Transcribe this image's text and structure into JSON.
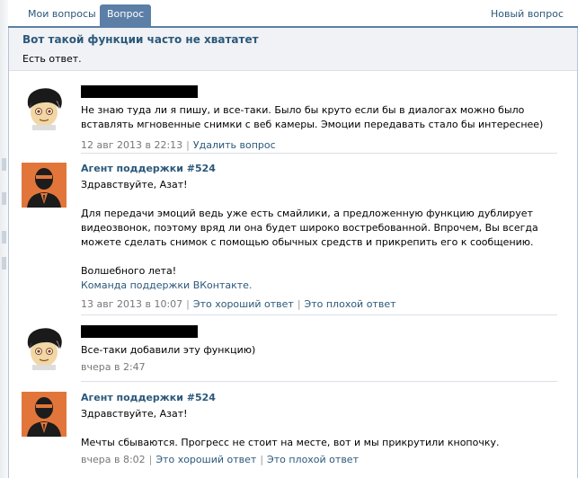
{
  "tabs": {
    "my_questions": "Мои вопросы",
    "question": "Вопрос",
    "new_question": "Новый вопрос"
  },
  "question": {
    "title": "Вот такой функции часто не хвататет",
    "status": "Есть ответ."
  },
  "messages": [
    {
      "author": "",
      "author_redacted": true,
      "avatar": "user-avatar-icon",
      "paragraphs": [
        "Не знаю туда ли я пишу, и все-таки. Было бы круто если бы в диалогах можно было вставлять мгновенные снимки с веб камеры. Эмоции передавать стало бы интереснее)"
      ],
      "date": "12 авг 2013 в 22:13",
      "actions": [
        "Удалить вопрос"
      ]
    },
    {
      "author": "Агент поддержки #524",
      "avatar": "support-agent-avatar-icon",
      "paragraphs": [
        "Здравствуйте, Азат!",
        "Для передачи эмоций ведь уже есть смайлики, а предложенную функцию дублирует видеозвонок, поэтому вряд ли она будет широко востребованной. Впрочем, Вы всегда можете сделать снимок с помощью обычных средств и прикрепить его к сообщению.",
        "Волшебного лета!"
      ],
      "signature": "Команда поддержки ВКонтакте.",
      "date": "13 авг 2013 в 10:07",
      "actions": [
        "Это хороший ответ",
        "Это плохой ответ"
      ]
    },
    {
      "author": "",
      "author_redacted": true,
      "avatar": "user-avatar-icon",
      "paragraphs": [
        "Все-таки добавили эту функцию)"
      ],
      "date": "вчера в 2:47",
      "actions": []
    },
    {
      "author": "Агент поддержки #524",
      "avatar": "support-agent-avatar-icon",
      "paragraphs": [
        "Здравствуйте, Азат!",
        "Мечты сбываются. Прогресс не стоит на месте, вот и мы прикрутили кнопочку."
      ],
      "date": "вчера в 8:02",
      "actions": [
        "Это хороший ответ",
        "Это плохой ответ"
      ]
    }
  ],
  "colors": {
    "accent": "#5b7fa6",
    "link": "#2b587a",
    "agent_avatar_bg": "#e2763a"
  }
}
